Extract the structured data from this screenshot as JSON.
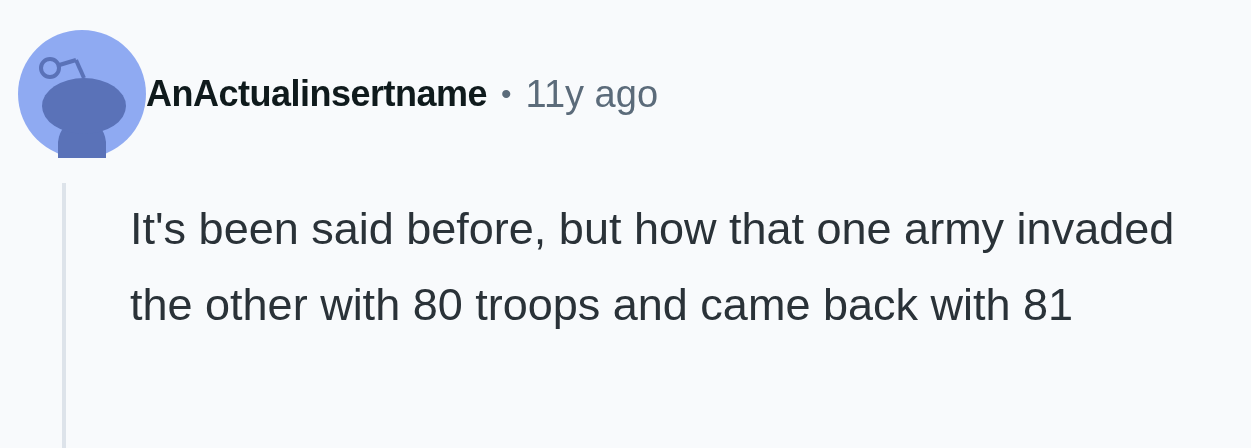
{
  "comment": {
    "author": "AnActualinsertname",
    "separator": "•",
    "age": "11y ago",
    "body": "It's been said before, but how that one army invaded the other with 80 troops and came back with 81"
  }
}
